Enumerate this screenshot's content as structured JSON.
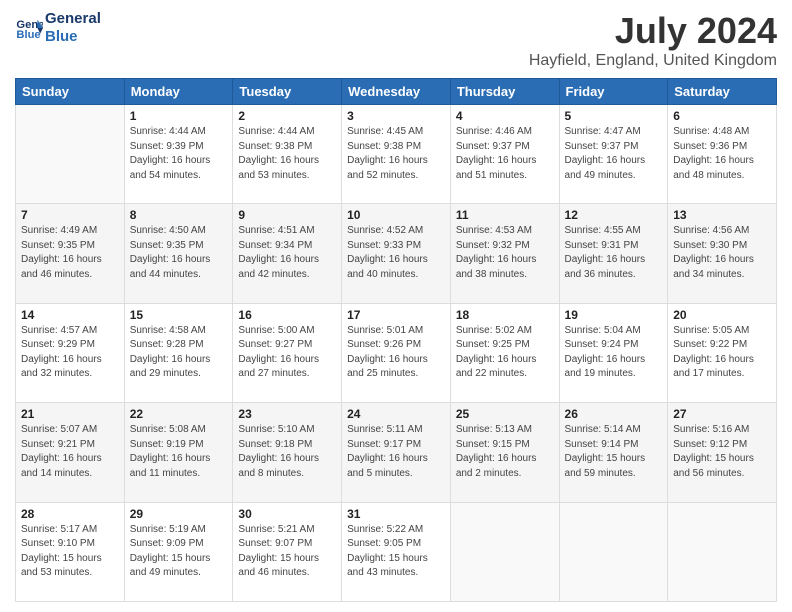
{
  "header": {
    "logo_line1": "General",
    "logo_line2": "Blue",
    "title": "July 2024",
    "subtitle": "Hayfield, England, United Kingdom"
  },
  "calendar": {
    "days_of_week": [
      "Sunday",
      "Monday",
      "Tuesday",
      "Wednesday",
      "Thursday",
      "Friday",
      "Saturday"
    ],
    "weeks": [
      [
        {
          "day": "",
          "info": ""
        },
        {
          "day": "1",
          "info": "Sunrise: 4:44 AM\nSunset: 9:39 PM\nDaylight: 16 hours\nand 54 minutes."
        },
        {
          "day": "2",
          "info": "Sunrise: 4:44 AM\nSunset: 9:38 PM\nDaylight: 16 hours\nand 53 minutes."
        },
        {
          "day": "3",
          "info": "Sunrise: 4:45 AM\nSunset: 9:38 PM\nDaylight: 16 hours\nand 52 minutes."
        },
        {
          "day": "4",
          "info": "Sunrise: 4:46 AM\nSunset: 9:37 PM\nDaylight: 16 hours\nand 51 minutes."
        },
        {
          "day": "5",
          "info": "Sunrise: 4:47 AM\nSunset: 9:37 PM\nDaylight: 16 hours\nand 49 minutes."
        },
        {
          "day": "6",
          "info": "Sunrise: 4:48 AM\nSunset: 9:36 PM\nDaylight: 16 hours\nand 48 minutes."
        }
      ],
      [
        {
          "day": "7",
          "info": "Sunrise: 4:49 AM\nSunset: 9:35 PM\nDaylight: 16 hours\nand 46 minutes."
        },
        {
          "day": "8",
          "info": "Sunrise: 4:50 AM\nSunset: 9:35 PM\nDaylight: 16 hours\nand 44 minutes."
        },
        {
          "day": "9",
          "info": "Sunrise: 4:51 AM\nSunset: 9:34 PM\nDaylight: 16 hours\nand 42 minutes."
        },
        {
          "day": "10",
          "info": "Sunrise: 4:52 AM\nSunset: 9:33 PM\nDaylight: 16 hours\nand 40 minutes."
        },
        {
          "day": "11",
          "info": "Sunrise: 4:53 AM\nSunset: 9:32 PM\nDaylight: 16 hours\nand 38 minutes."
        },
        {
          "day": "12",
          "info": "Sunrise: 4:55 AM\nSunset: 9:31 PM\nDaylight: 16 hours\nand 36 minutes."
        },
        {
          "day": "13",
          "info": "Sunrise: 4:56 AM\nSunset: 9:30 PM\nDaylight: 16 hours\nand 34 minutes."
        }
      ],
      [
        {
          "day": "14",
          "info": "Sunrise: 4:57 AM\nSunset: 9:29 PM\nDaylight: 16 hours\nand 32 minutes."
        },
        {
          "day": "15",
          "info": "Sunrise: 4:58 AM\nSunset: 9:28 PM\nDaylight: 16 hours\nand 29 minutes."
        },
        {
          "day": "16",
          "info": "Sunrise: 5:00 AM\nSunset: 9:27 PM\nDaylight: 16 hours\nand 27 minutes."
        },
        {
          "day": "17",
          "info": "Sunrise: 5:01 AM\nSunset: 9:26 PM\nDaylight: 16 hours\nand 25 minutes."
        },
        {
          "day": "18",
          "info": "Sunrise: 5:02 AM\nSunset: 9:25 PM\nDaylight: 16 hours\nand 22 minutes."
        },
        {
          "day": "19",
          "info": "Sunrise: 5:04 AM\nSunset: 9:24 PM\nDaylight: 16 hours\nand 19 minutes."
        },
        {
          "day": "20",
          "info": "Sunrise: 5:05 AM\nSunset: 9:22 PM\nDaylight: 16 hours\nand 17 minutes."
        }
      ],
      [
        {
          "day": "21",
          "info": "Sunrise: 5:07 AM\nSunset: 9:21 PM\nDaylight: 16 hours\nand 14 minutes."
        },
        {
          "day": "22",
          "info": "Sunrise: 5:08 AM\nSunset: 9:19 PM\nDaylight: 16 hours\nand 11 minutes."
        },
        {
          "day": "23",
          "info": "Sunrise: 5:10 AM\nSunset: 9:18 PM\nDaylight: 16 hours\nand 8 minutes."
        },
        {
          "day": "24",
          "info": "Sunrise: 5:11 AM\nSunset: 9:17 PM\nDaylight: 16 hours\nand 5 minutes."
        },
        {
          "day": "25",
          "info": "Sunrise: 5:13 AM\nSunset: 9:15 PM\nDaylight: 16 hours\nand 2 minutes."
        },
        {
          "day": "26",
          "info": "Sunrise: 5:14 AM\nSunset: 9:14 PM\nDaylight: 15 hours\nand 59 minutes."
        },
        {
          "day": "27",
          "info": "Sunrise: 5:16 AM\nSunset: 9:12 PM\nDaylight: 15 hours\nand 56 minutes."
        }
      ],
      [
        {
          "day": "28",
          "info": "Sunrise: 5:17 AM\nSunset: 9:10 PM\nDaylight: 15 hours\nand 53 minutes."
        },
        {
          "day": "29",
          "info": "Sunrise: 5:19 AM\nSunset: 9:09 PM\nDaylight: 15 hours\nand 49 minutes."
        },
        {
          "day": "30",
          "info": "Sunrise: 5:21 AM\nSunset: 9:07 PM\nDaylight: 15 hours\nand 46 minutes."
        },
        {
          "day": "31",
          "info": "Sunrise: 5:22 AM\nSunset: 9:05 PM\nDaylight: 15 hours\nand 43 minutes."
        },
        {
          "day": "",
          "info": ""
        },
        {
          "day": "",
          "info": ""
        },
        {
          "day": "",
          "info": ""
        }
      ]
    ]
  }
}
